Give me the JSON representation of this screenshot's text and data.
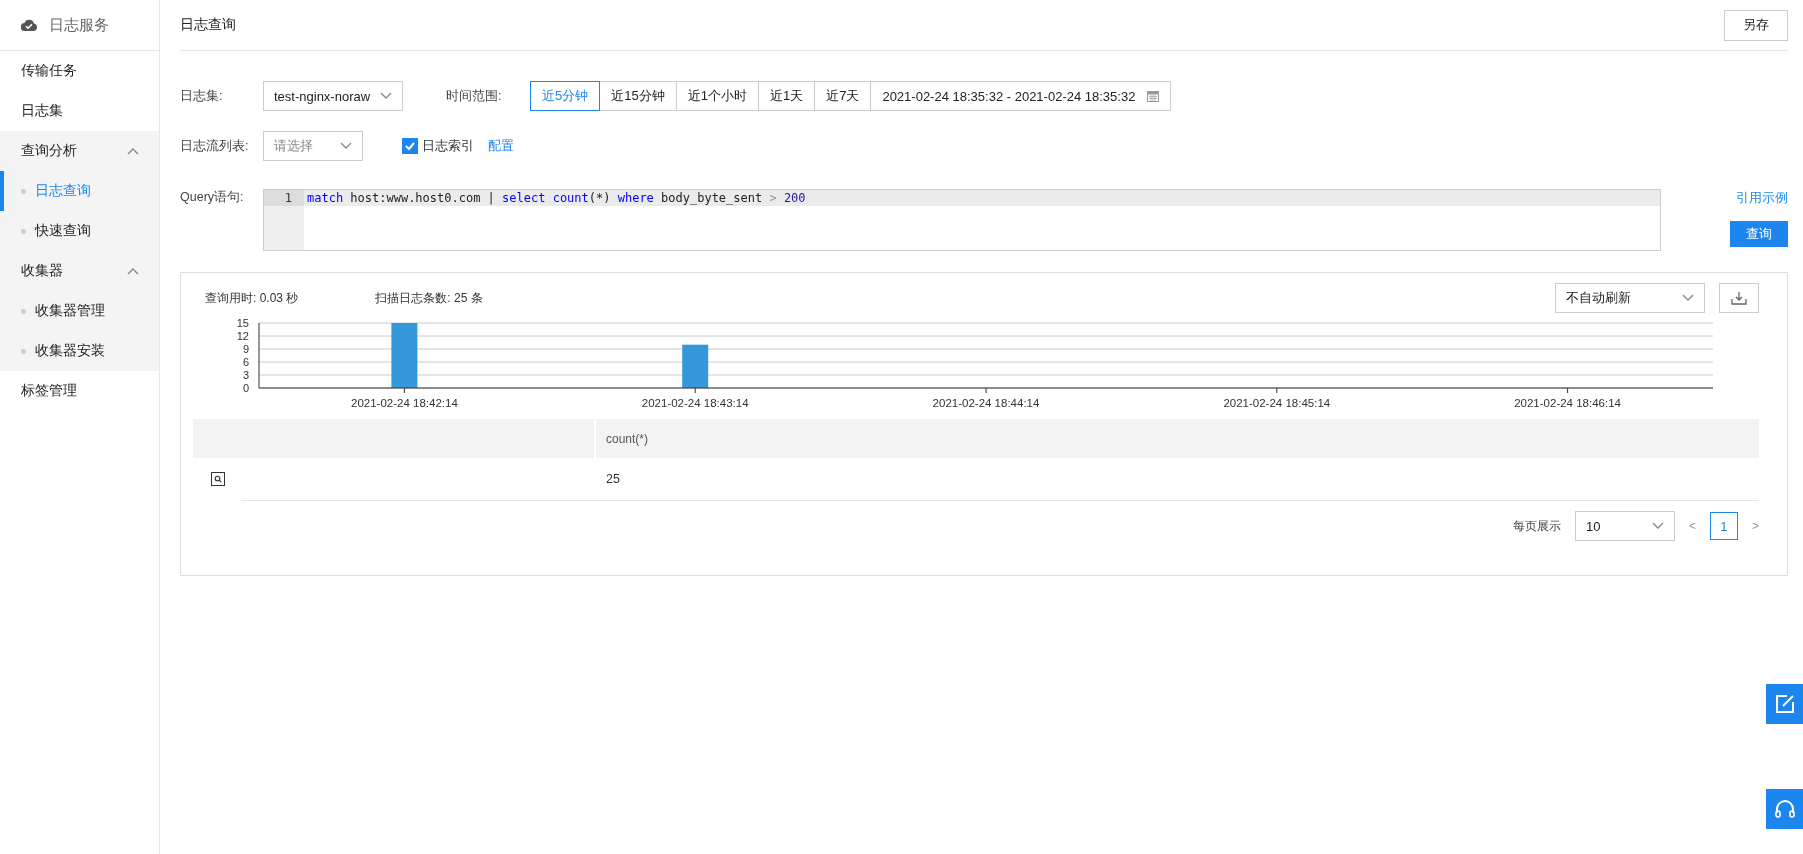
{
  "sidebar": {
    "title": "日志服务",
    "items": [
      {
        "label": "传输任务",
        "selected": false
      },
      {
        "label": "日志集",
        "selected": false
      },
      {
        "label": "查询分析",
        "selected": false,
        "expanded": true,
        "children": [
          {
            "label": "日志查询",
            "selected": true
          },
          {
            "label": "快速查询",
            "selected": false
          }
        ]
      },
      {
        "label": "收集器",
        "selected": false,
        "expanded": true,
        "children": [
          {
            "label": "收集器管理",
            "selected": false
          },
          {
            "label": "收集器安装",
            "selected": false
          }
        ]
      },
      {
        "label": "标签管理",
        "selected": false
      }
    ]
  },
  "page": {
    "title": "日志查询",
    "save_button": "另存"
  },
  "form": {
    "logset_label": "日志集:",
    "logset_value": "test-nginx-noraw",
    "time_label": "时间范围:",
    "time_ranges": [
      {
        "label": "近5分钟",
        "selected": true
      },
      {
        "label": "近15分钟",
        "selected": false
      },
      {
        "label": "近1个小时",
        "selected": false
      },
      {
        "label": "近1天",
        "selected": false
      },
      {
        "label": "近7天",
        "selected": false
      }
    ],
    "date_range": "2021-02-24 18:35:32 - 2021-02-24 18:35:32",
    "stream_label": "日志流列表:",
    "stream_placeholder": "请选择",
    "index_label": "日志索引",
    "index_checked": true,
    "config_link": "配置",
    "query_label": "Query语句:",
    "line_number": "1",
    "query_tokens": [
      {
        "kind": "keyword",
        "text": "match"
      },
      {
        "kind": "plain",
        "text": " host:www.host0.com | "
      },
      {
        "kind": "keyword",
        "text": "select"
      },
      {
        "kind": "keyword",
        "text": " count"
      },
      {
        "kind": "plain",
        "text": "(*) "
      },
      {
        "kind": "keyword",
        "text": "where"
      },
      {
        "kind": "plain",
        "text": " body_byte_sent "
      },
      {
        "kind": "operator",
        "text": ">"
      },
      {
        "kind": "number",
        "text": " 200"
      }
    ],
    "example_link": "引用示例",
    "query_button": "查询"
  },
  "results": {
    "elapsed": "查询用时: 0.03 秒",
    "scanned": "扫描日志条数: 25 条",
    "refresh": "不自动刷新",
    "chart_data": {
      "type": "bar",
      "categories": [
        "2021-02-24 18:42:14",
        "2021-02-24 18:43:14",
        "2021-02-24 18:44:14",
        "2021-02-24 18:45:14",
        "2021-02-24 18:46:14"
      ],
      "values": [
        15,
        10,
        0,
        0,
        0
      ],
      "ylim": [
        0,
        15
      ],
      "grid": true,
      "yticks": [
        0,
        3,
        6,
        9,
        12,
        15
      ]
    },
    "table": {
      "columns": [
        "",
        "count(*)"
      ],
      "rows": [
        {
          "cells": [
            "",
            "25"
          ]
        }
      ]
    },
    "pagination": {
      "per_page_label": "每页展示",
      "per_page": "10",
      "prev": "<",
      "pages": [
        {
          "label": "1",
          "selected": true
        }
      ],
      "next": ">"
    }
  }
}
